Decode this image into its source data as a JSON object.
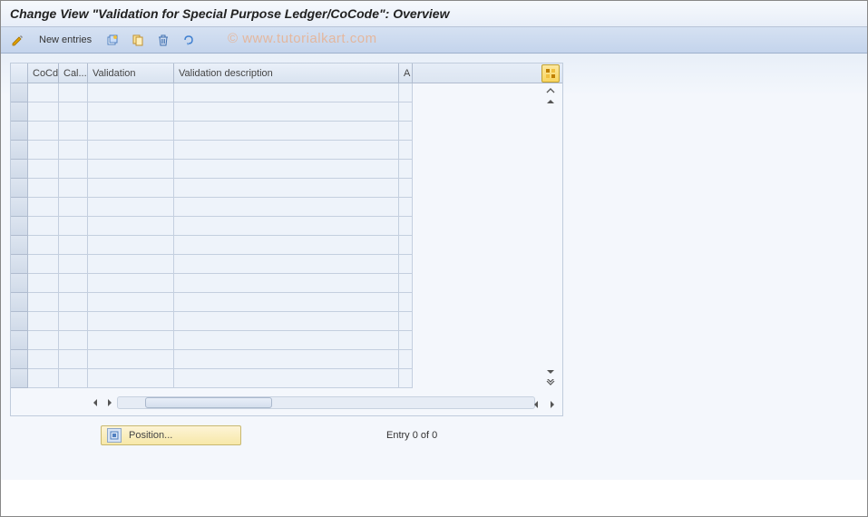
{
  "header": {
    "title": "Change View \"Validation for Special Purpose Ledger/CoCode\": Overview"
  },
  "toolbar": {
    "new_entries_label": "New entries"
  },
  "watermark": "© www.tutorialkart.com",
  "grid": {
    "columns": {
      "cocd": "CoCd",
      "cal": "Cal...",
      "validation": "Validation",
      "desc": "Validation description",
      "a": "A"
    },
    "row_count": 16
  },
  "footer": {
    "position_label": "Position...",
    "entry_label": "Entry 0 of 0"
  }
}
